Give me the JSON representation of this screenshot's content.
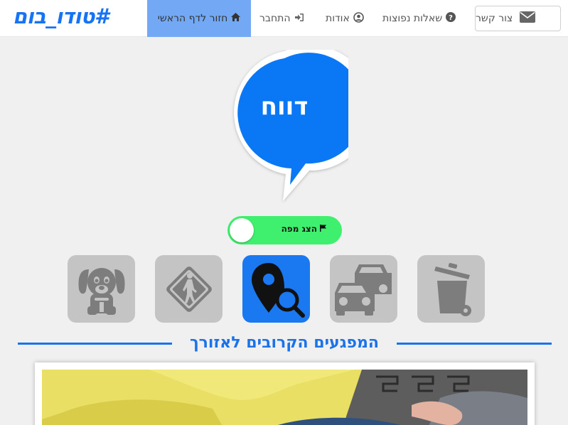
{
  "navbar": {
    "logo": "#טודו_בום",
    "contact_label": "צור קשר",
    "faq_label": "שאלות נפוצות",
    "about_label": "אודות",
    "login_label": "התחבר",
    "home_label": "חזור לדף הראשי",
    "icons": {
      "contact": "envelope-icon",
      "faq": "question-circle-icon",
      "about": "user-circle-icon",
      "login": "sign-in-icon",
      "home": "home-icon"
    }
  },
  "report_bubble": {
    "label": "דווח",
    "color": "#0a78f5"
  },
  "map_toggle": {
    "label": "הצג מפה",
    "icon": "flag-icon",
    "on": true,
    "color": "#3ef06e"
  },
  "categories": [
    {
      "icon": "dog-icon",
      "active": false
    },
    {
      "icon": "pedestrian-sign-icon",
      "active": false
    },
    {
      "icon": "map-pin-search-icon",
      "active": true
    },
    {
      "icon": "traffic-cars-icon",
      "active": false
    },
    {
      "icon": "trash-bin-icon",
      "active": false
    }
  ],
  "section": {
    "title": "המפגעים הקרובים לאזורך",
    "accent": "#1a73e8"
  }
}
